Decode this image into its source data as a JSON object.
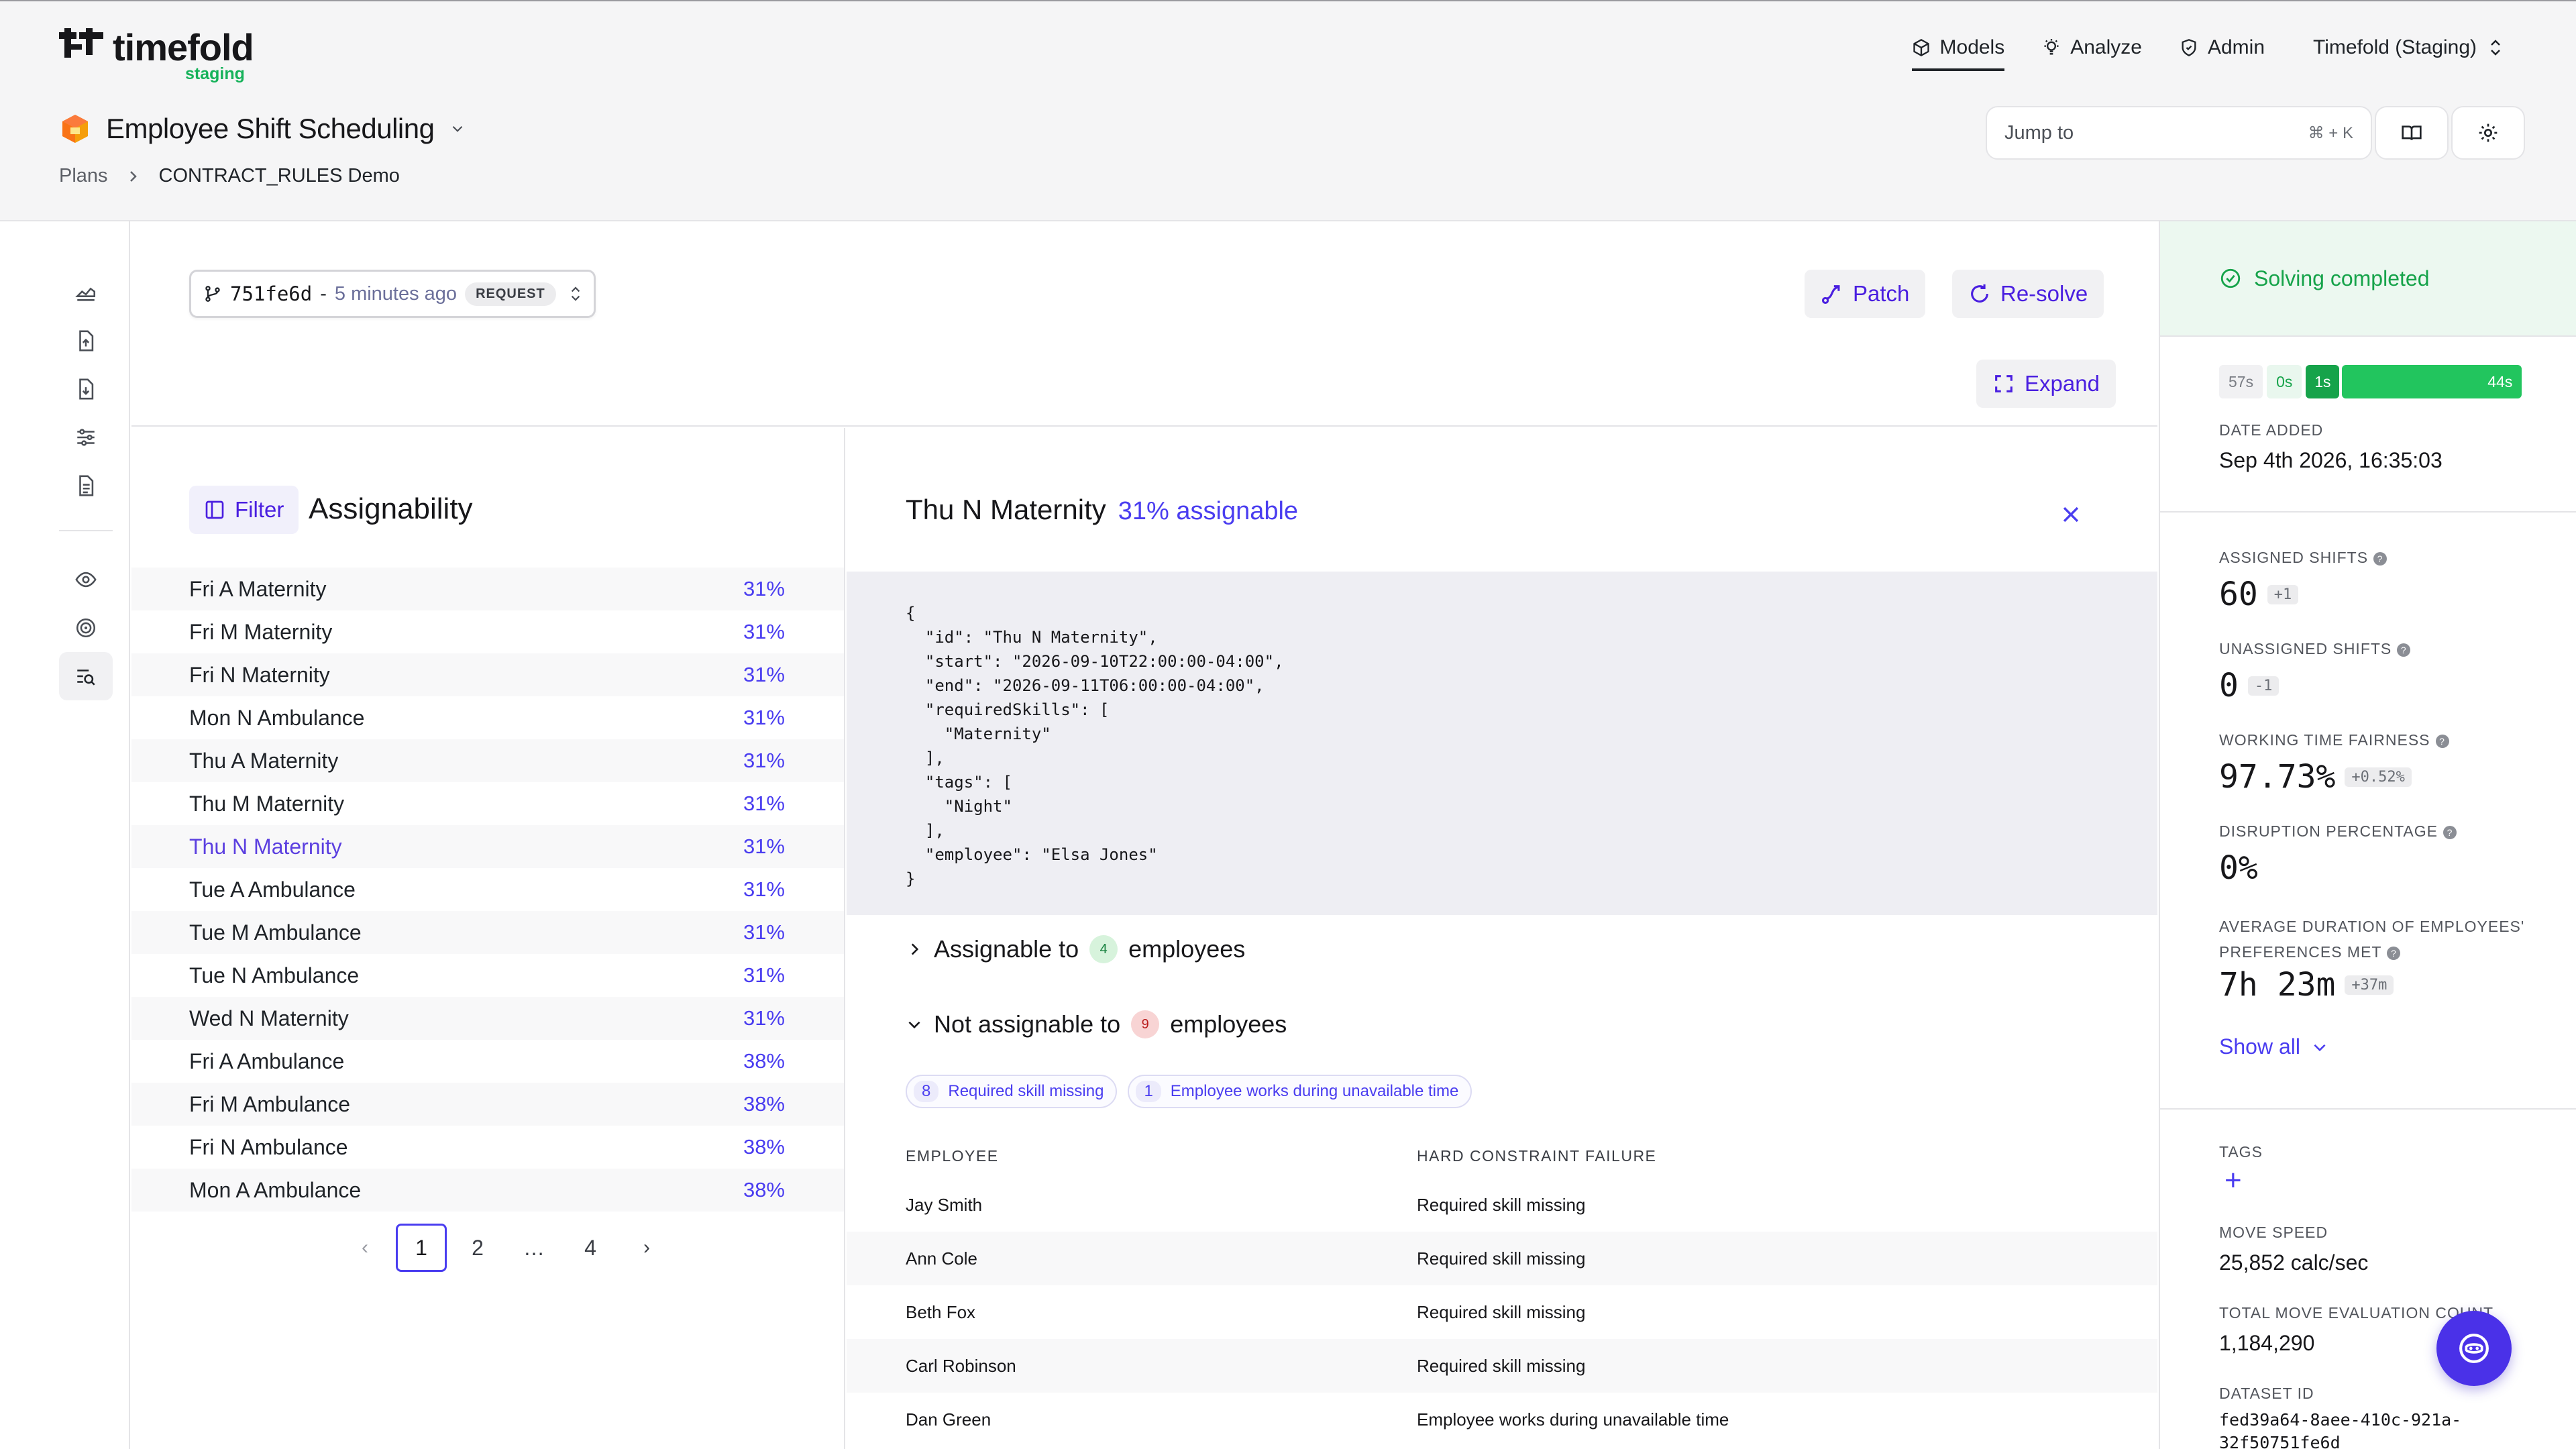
{
  "brand": {
    "name": "timefold",
    "env": "staging"
  },
  "nav": {
    "items": [
      {
        "label": "Models",
        "icon": "cube-icon"
      },
      {
        "label": "Analyze",
        "icon": "bulb-icon"
      },
      {
        "label": "Admin",
        "icon": "shield-icon"
      }
    ],
    "org": "Timefold (Staging)"
  },
  "page": {
    "title": "Employee Shift Scheduling",
    "breadcrumb": {
      "root": "Plans",
      "current": "CONTRACT_RULES Demo"
    }
  },
  "search": {
    "label": "Jump to",
    "shortcut": "⌘ + K"
  },
  "toolbar": {
    "version": {
      "hash": "751fe6d",
      "sep": "-",
      "ago": "5 minutes ago",
      "badge": "REQUEST"
    },
    "patch": "Patch",
    "resolve": "Re-solve",
    "expand": "Expand"
  },
  "assignability": {
    "filter": "Filter",
    "title": "Assignability",
    "rows": [
      {
        "name": "Fri A Maternity",
        "pct": "31%"
      },
      {
        "name": "Fri M Maternity",
        "pct": "31%"
      },
      {
        "name": "Fri N Maternity",
        "pct": "31%"
      },
      {
        "name": "Mon N Ambulance",
        "pct": "31%"
      },
      {
        "name": "Thu A Maternity",
        "pct": "31%"
      },
      {
        "name": "Thu M Maternity",
        "pct": "31%"
      },
      {
        "name": "Thu N Maternity",
        "pct": "31%"
      },
      {
        "name": "Tue A Ambulance",
        "pct": "31%"
      },
      {
        "name": "Tue M Ambulance",
        "pct": "31%"
      },
      {
        "name": "Tue N Ambulance",
        "pct": "31%"
      },
      {
        "name": "Wed N Maternity",
        "pct": "31%"
      },
      {
        "name": "Fri A Ambulance",
        "pct": "38%"
      },
      {
        "name": "Fri M Ambulance",
        "pct": "38%"
      },
      {
        "name": "Fri N Ambulance",
        "pct": "38%"
      },
      {
        "name": "Mon A Ambulance",
        "pct": "38%"
      }
    ],
    "pager": {
      "prev": "‹",
      "pages": [
        "1",
        "2",
        "…",
        "4"
      ],
      "next": "›",
      "current": "1"
    }
  },
  "detail": {
    "title": "Thu N Maternity",
    "subtitle": "31% assignable",
    "json": "{\n  \"id\": \"Thu N Maternity\",\n  \"start\": \"2026-09-10T22:00:00-04:00\",\n  \"end\": \"2026-09-11T06:00:00-04:00\",\n  \"requiredSkills\": [\n    \"Maternity\"\n  ],\n  \"tags\": [\n    \"Night\"\n  ],\n  \"employee\": \"Elsa Jones\"\n}",
    "assignable": {
      "label_pre": "Assignable to",
      "count": "4",
      "label_post": "employees"
    },
    "not_assignable": {
      "label_pre": "Not assignable to",
      "count": "9",
      "label_post": "employees"
    },
    "chips": [
      {
        "count": "8",
        "label": "Required skill missing"
      },
      {
        "count": "1",
        "label": "Employee works during unavailable time"
      }
    ],
    "table": {
      "headers": [
        "EMPLOYEE",
        "HARD CONSTRAINT FAILURE"
      ],
      "rows": [
        {
          "employee": "Jay Smith",
          "failure": "Required skill missing"
        },
        {
          "employee": "Ann Cole",
          "failure": "Required skill missing"
        },
        {
          "employee": "Beth Fox",
          "failure": "Required skill missing"
        },
        {
          "employee": "Carl Robinson",
          "failure": "Required skill missing"
        },
        {
          "employee": "Dan Green",
          "failure": "Employee works during unavailable time"
        }
      ]
    }
  },
  "status": {
    "state": "Solving completed",
    "timeline": [
      "57s",
      "0s",
      "1s",
      "44s"
    ],
    "date_label": "DATE ADDED",
    "date_value": "Sep 4th 2026, 16:35:03",
    "metrics": [
      {
        "label": "ASSIGNED SHIFTS",
        "value": "60",
        "delta": "+1"
      },
      {
        "label": "UNASSIGNED SHIFTS",
        "value": "0",
        "delta": "-1"
      },
      {
        "label": "WORKING TIME FAIRNESS",
        "value": "97.73%",
        "delta": "+0.52%"
      },
      {
        "label": "DISRUPTION PERCENTAGE",
        "value": "0%",
        "delta": ""
      },
      {
        "label_line1": "AVERAGE DURATION OF EMPLOYEES'",
        "label_line2": "PREFERENCES MET",
        "value": "7h 23m",
        "delta": "+37m"
      }
    ],
    "show_all": "Show all",
    "tags_label": "TAGS",
    "move_speed_label": "MOVE SPEED",
    "move_speed_value": "25,852 calc/sec",
    "move_count_label": "TOTAL MOVE EVALUATION COUNT",
    "move_count_value": "1,184,290",
    "dataset_label": "DATASET ID",
    "dataset_line1": "fed39a64-8aee-410c-921a-",
    "dataset_line2": "32f50751fe6d"
  },
  "colors": {
    "accent": "#4a3df0",
    "success": "#16a34a",
    "brand_orange": "#f59e0b"
  }
}
